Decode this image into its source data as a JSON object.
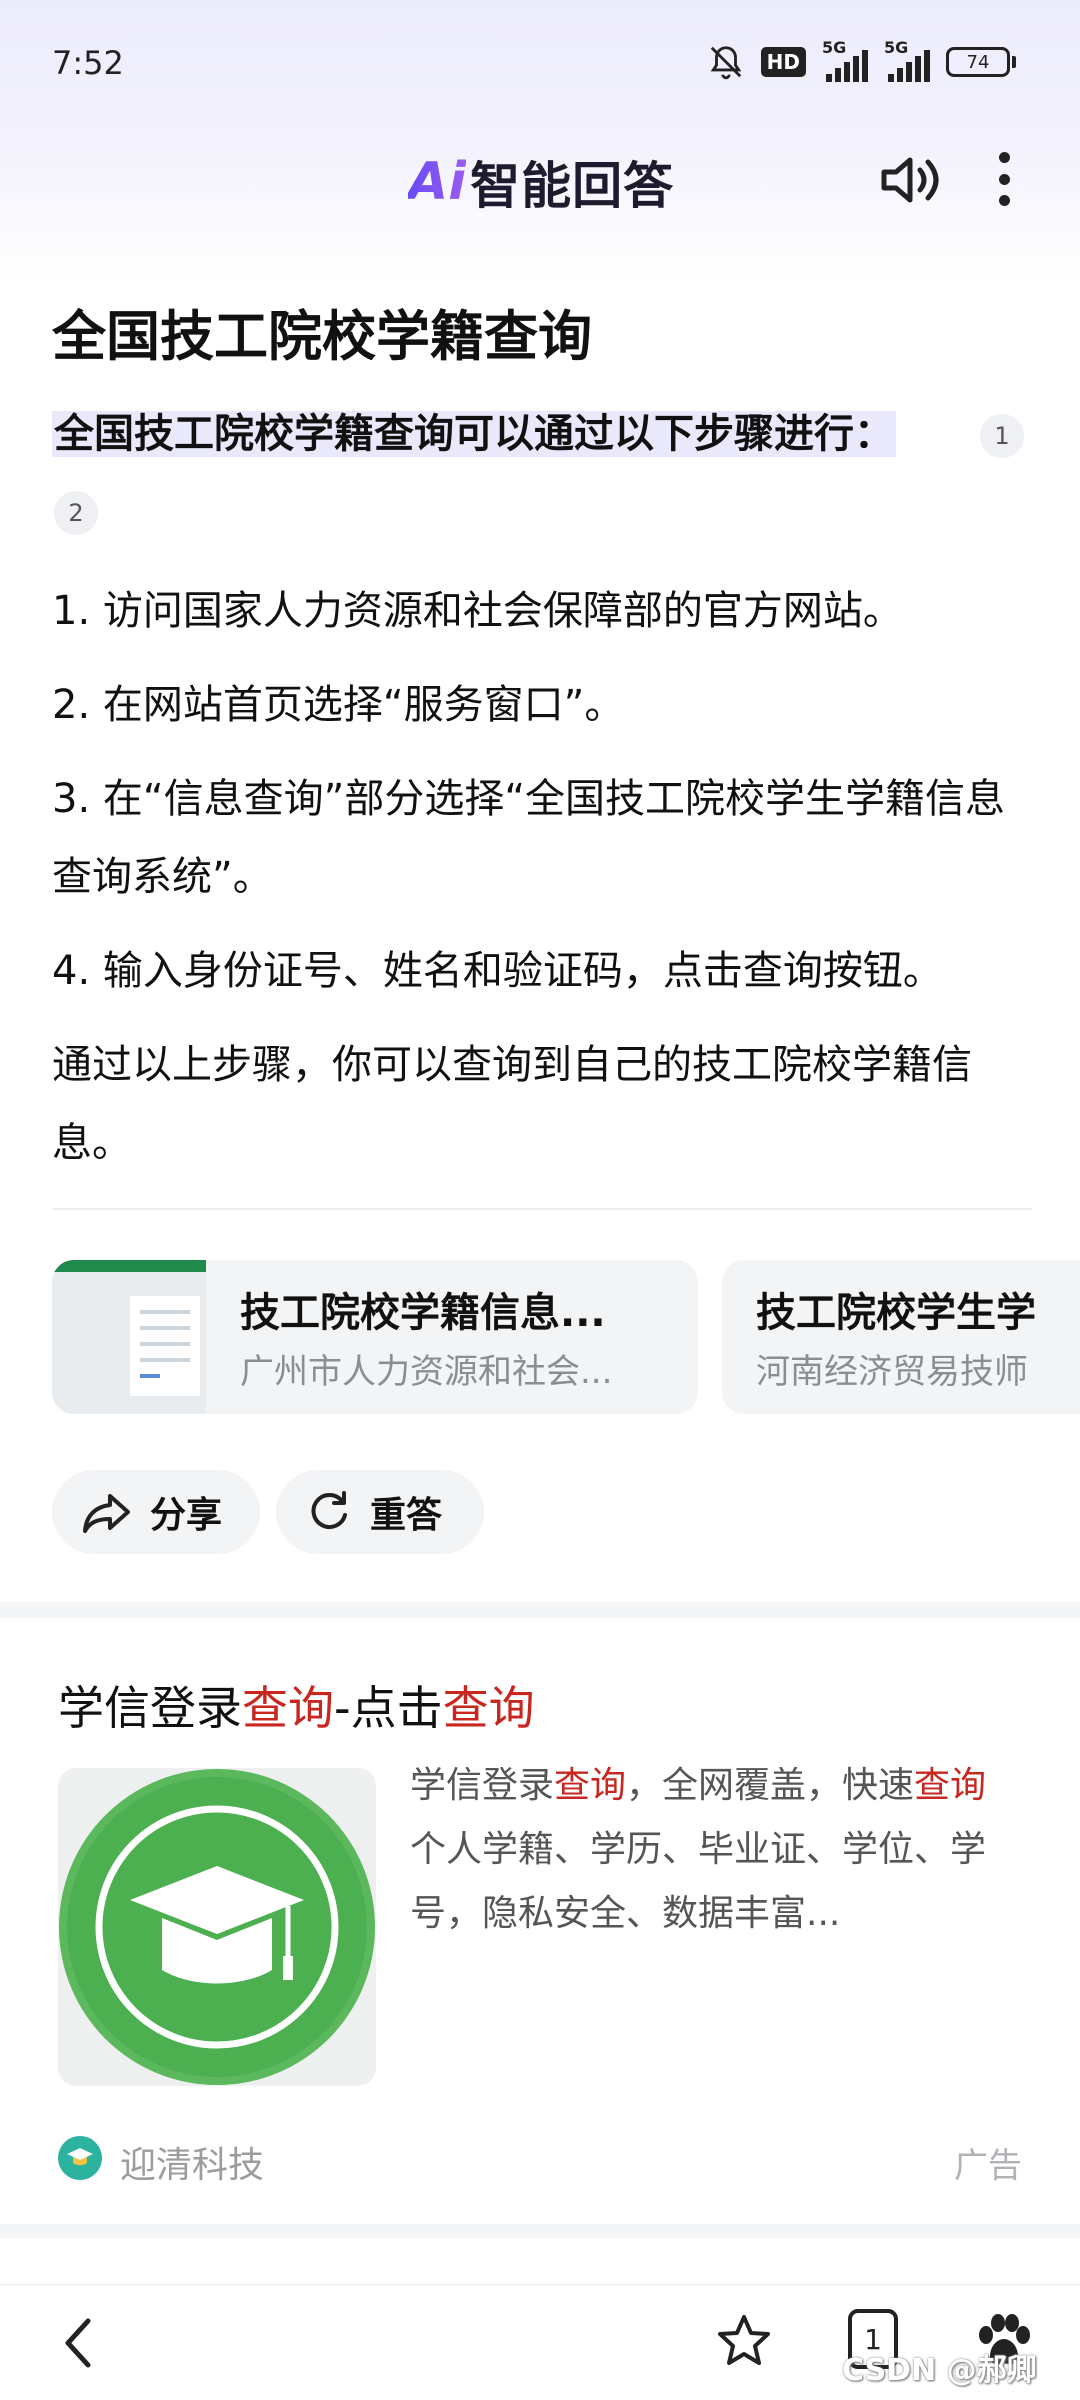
{
  "status_bar": {
    "time": "7:52",
    "hd_label": "HD",
    "net1": "5G",
    "net2": "5G",
    "battery": "74"
  },
  "header": {
    "brand_ai": "Ai",
    "brand_text": "智能回答",
    "icons": [
      "speaker-icon",
      "more-vert-icon"
    ]
  },
  "answer": {
    "title": "全国技工院校学籍查询",
    "intro": "全国技工院校学籍查询可以通过以下步骤进行：",
    "citations": [
      "1",
      "2"
    ],
    "steps": [
      "1. 访问国家人力资源和社会保障部的官方网站。",
      "2. 在网站首页选择“服务窗口”。",
      "3. 在“信息查询”部分选择“全国技工院校学生学籍信息查询系统”。",
      "4. 输入身份证号、姓名和验证码，点击查询按钮。"
    ],
    "conclusion": "通过以上步骤，你可以查询到自己的技工院校学籍信息。"
  },
  "sources": [
    {
      "title": "技工院校学籍信息...",
      "subtitle": "广州市人力资源和社会..."
    },
    {
      "title": "技工院校学生学",
      "subtitle": "河南经济贸易技师"
    }
  ],
  "actions": {
    "share": "分享",
    "regenerate": "重答"
  },
  "ad": {
    "title_parts": [
      "学信登录",
      "查询",
      "-点击",
      "查询"
    ],
    "desc_parts": [
      "学信登录",
      "查询",
      "，全网覆盖，快速",
      "查询",
      "个人学籍、学历、毕业证、学位、学号，隐私安全、数据丰富..."
    ],
    "source": "迎清科技",
    "label": "广告"
  },
  "bottom_bar": {
    "tab_count": "1",
    "watermark": "CSDN @郝卿"
  },
  "colors": {
    "accent": "#6b4cf0",
    "highlight": "#eae8fb",
    "ad_red": "#c8261f",
    "ad_green": "#4caf50"
  }
}
